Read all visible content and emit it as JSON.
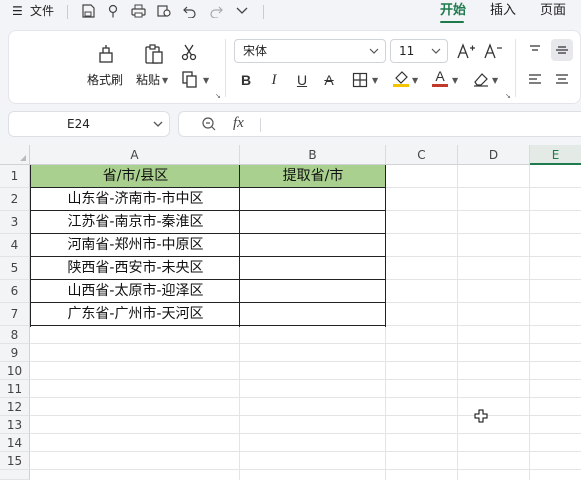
{
  "menubar": {
    "menu_icon": "☰",
    "file_label": "文件",
    "quick_icons": [
      "save-icon",
      "format-painter-icon",
      "print-icon",
      "print-preview-icon",
      "undo-icon",
      "redo-icon",
      "more-icon"
    ],
    "tabs": [
      {
        "label": "开始",
        "active": true
      },
      {
        "label": "插入",
        "active": false
      },
      {
        "label": "页面",
        "active": false
      }
    ]
  },
  "ribbon": {
    "format_painter_label": "格式刷",
    "paste_label": "粘贴",
    "font_name": "宋体",
    "font_size": "11",
    "bold": "B",
    "italic": "I",
    "underline": "U",
    "strike": "A",
    "font_color_letter": "A",
    "fill_color": "#f5c400",
    "font_color": "#c0392b"
  },
  "formula_bar": {
    "name_box": "E24",
    "fx_label": "fx",
    "content": ""
  },
  "sheet": {
    "columns": [
      "A",
      "B",
      "C",
      "D",
      "E"
    ],
    "selected_column": "E",
    "rows": [
      "1",
      "2",
      "3",
      "4",
      "5",
      "6",
      "7",
      "8",
      "9",
      "10",
      "11",
      "12",
      "13",
      "14",
      "15"
    ],
    "header_fill": "#a9d08e",
    "table": {
      "headers": [
        "省/市/县区",
        "提取省/市"
      ],
      "rows": [
        [
          "山东省-济南市-市中区",
          ""
        ],
        [
          "江苏省-南京市-秦淮区",
          ""
        ],
        [
          "河南省-郑州市-中原区",
          ""
        ],
        [
          "陕西省-西安市-未央区",
          ""
        ],
        [
          "山西省-太原市-迎泽区",
          ""
        ],
        [
          "广东省-广州市-天河区",
          ""
        ]
      ]
    }
  }
}
